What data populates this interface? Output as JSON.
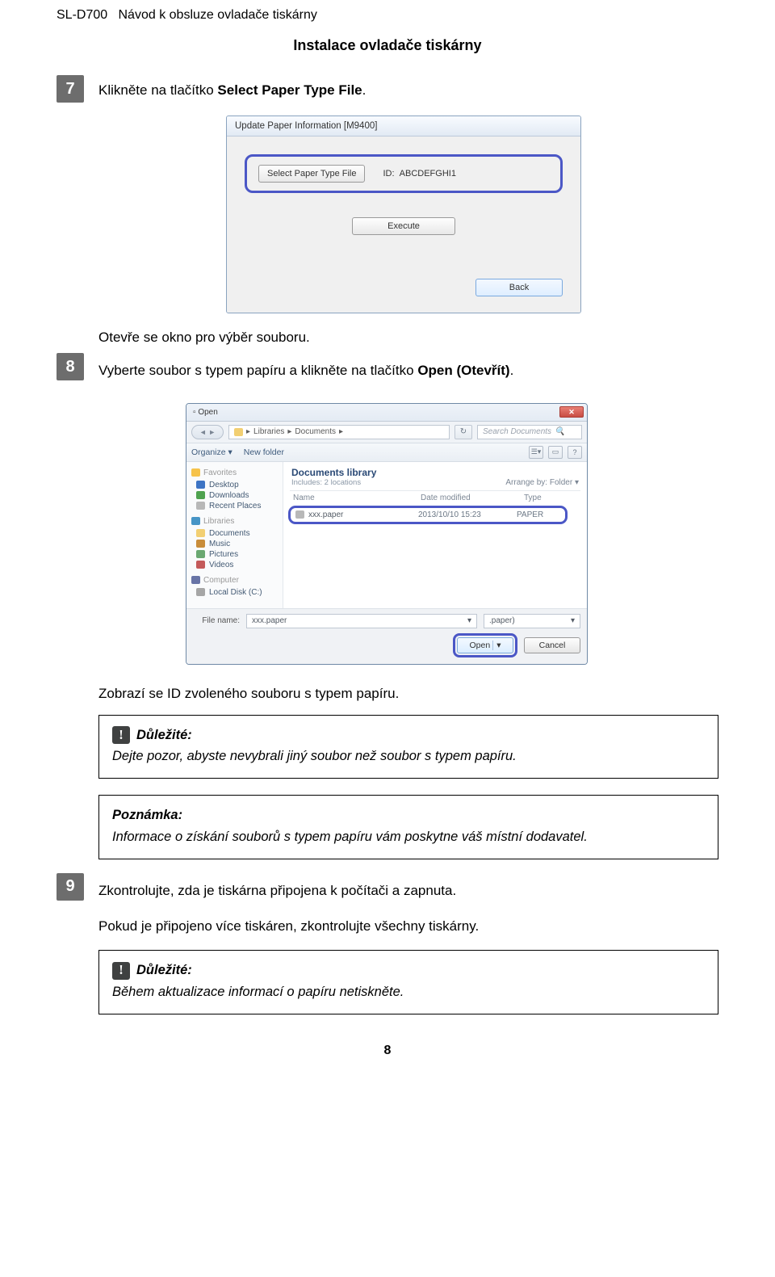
{
  "header": {
    "model": "SL-D700",
    "doc_title": "Návod k obsluze ovladače tiskárny"
  },
  "section_title": "Instalace ovladače tiskárny",
  "step7": {
    "num": "7",
    "text_before": "Klikněte na tlačítko ",
    "bold": "Select Paper Type File",
    "text_after": "."
  },
  "dialog1": {
    "title": "Update Paper Information [M9400]",
    "select_btn": "Select Paper Type File",
    "id_label": "ID:",
    "id_value": "ABCDEFGHI1",
    "execute_btn": "Execute",
    "back_btn": "Back"
  },
  "under_d1": "Otevře se okno pro výběr souboru.",
  "step8": {
    "num": "8",
    "text_before": "Vyberte soubor s typem papíru a klikněte na tlačítko ",
    "bold": "Open (Otevřít)",
    "text_after": "."
  },
  "dialog2": {
    "title": "Open",
    "breadcrumb_1": "Libraries",
    "breadcrumb_2": "Documents",
    "search_placeholder": "Search Documents",
    "toolbar_organize": "Organize ▾",
    "toolbar_newfolder": "New folder",
    "nav": {
      "favorites": "Favorites",
      "desktop": "Desktop",
      "downloads": "Downloads",
      "recent": "Recent Places",
      "libraries": "Libraries",
      "documents": "Documents",
      "music": "Music",
      "pictures": "Pictures",
      "videos": "Videos",
      "computer": "Computer",
      "localdisk": "Local Disk (C:)"
    },
    "content": {
      "lib_title": "Documents library",
      "lib_sub": "Includes: 2 locations",
      "arrange": "Arrange by:  Folder ▾",
      "col_name": "Name",
      "col_date": "Date modified",
      "col_type": "Type",
      "file_name": "xxx.paper",
      "file_date": "2013/10/10 15:23",
      "file_type": "PAPER"
    },
    "bottom": {
      "filename_label": "File name:",
      "filename_value": "xxx.paper",
      "filetype_value": ".paper)",
      "open_btn": "Open",
      "cancel_btn": "Cancel"
    }
  },
  "under_d2": "Zobrazí se ID zvoleného souboru s typem papíru.",
  "important1": {
    "label": "Důležité:",
    "body": "Dejte pozor, abyste nevybrali jiný soubor než soubor s typem papíru."
  },
  "note1": {
    "label": "Poznámka:",
    "body": "Informace o získání souborů s typem papíru vám poskytne váš místní dodavatel."
  },
  "step9": {
    "num": "9",
    "line1": "Zkontrolujte, zda je tiskárna připojena k počítači a zapnuta.",
    "line2": "Pokud je připojeno více tiskáren, zkontrolujte všechny tiskárny."
  },
  "important2": {
    "label": "Důležité:",
    "body": "Během aktualizace informací o papíru netiskněte."
  },
  "page_num": "8"
}
